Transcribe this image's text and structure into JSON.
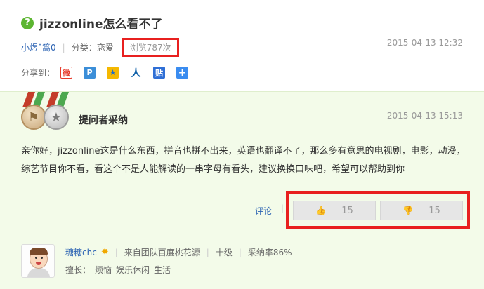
{
  "question": {
    "icon": "?",
    "title": "jizzonline怎么看不了",
    "asker": "小煜ˇ篙0",
    "category_label": "分类：恋爱",
    "views_label": "浏览787次",
    "date": "2015-04-13 12:32"
  },
  "share": {
    "label": "分享到：",
    "icons": [
      {
        "name": "sina-weibo-icon",
        "glyph": "微"
      },
      {
        "name": "qzone-icon",
        "glyph": "P"
      },
      {
        "name": "qq-weibo-icon",
        "glyph": "★"
      },
      {
        "name": "renren-icon",
        "glyph": "人"
      },
      {
        "name": "tieba-icon",
        "glyph": "贴"
      },
      {
        "name": "more-share-icon",
        "glyph": "+"
      }
    ]
  },
  "answer": {
    "adopted_label": "提问者采纳",
    "date": "2015-04-13 15:13",
    "text": "亲你好，jizzonline这是什么东西，拼音也拼不出来，英语也翻译不了，那么多有意思的电视剧，电影，动漫，综艺节目你不看，看这个不是人能解读的一串字母有看头，建议换换口味吧，希望可以帮助到你",
    "comment_label": "评论",
    "vote_separator": "|",
    "upvotes": "15",
    "downvotes": "15",
    "answerer": {
      "name": "糖糖chc",
      "team": "来自团队百度桃花源",
      "level": "十级",
      "adoption_rate": "采纳率86%",
      "expertise_label": "擅长：",
      "expertise": [
        "烦恼",
        "娱乐休闲",
        "生活"
      ]
    }
  },
  "colors": {
    "accent_green": "#5cb531",
    "link_blue": "#2d64b3",
    "highlight_red": "#e8201f",
    "answer_bg": "#f3fbe9"
  }
}
